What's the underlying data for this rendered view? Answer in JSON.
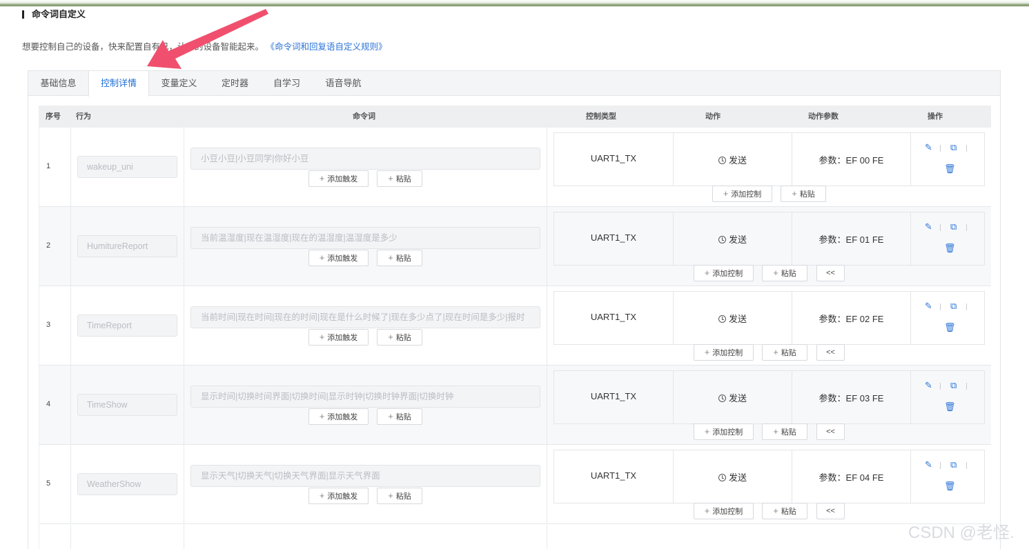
{
  "page": {
    "title": "命令词自定义",
    "description": "想要控制自己的设备，快来配置自有",
    "description_hidden_tail": "己，让你的设备智能起来。",
    "rules_link": "《命令词和回复语自定义规则》"
  },
  "tabs": [
    {
      "label": "基础信息",
      "active": false
    },
    {
      "label": "控制详情",
      "active": true
    },
    {
      "label": "变量定义",
      "active": false
    },
    {
      "label": "定时器",
      "active": false
    },
    {
      "label": "自学习",
      "active": false
    },
    {
      "label": "语音导航",
      "active": false
    }
  ],
  "table": {
    "headers": {
      "seq": "序号",
      "behavior": "行为",
      "command": "命令词",
      "control_type": "控制类型",
      "action": "动作",
      "action_params": "动作参数",
      "operations": "操作"
    },
    "buttons": {
      "add_trigger": "添加触发",
      "paste": "粘贴",
      "add_control": "添加控制",
      "collapse": "<<"
    },
    "rows": [
      {
        "seq": "1",
        "behavior": "wakeup_uni",
        "command": "小豆小豆|小豆同学|你好小豆",
        "control_type": "UART1_TX",
        "action": "发送",
        "params": "参数：EF 00 FE"
      },
      {
        "seq": "2",
        "behavior": "HumitureReport",
        "command": "当前温湿度|现在温湿度|现在的温湿度|温湿度是多少",
        "control_type": "UART1_TX",
        "action": "发送",
        "params": "参数：EF 01 FE"
      },
      {
        "seq": "3",
        "behavior": "TimeReport",
        "command": "当前时间|现在时间|现在的时间|现在是什么时候了|现在多少点了|现在时间是多少|报时",
        "control_type": "UART1_TX",
        "action": "发送",
        "params": "参数：EF 02 FE"
      },
      {
        "seq": "4",
        "behavior": "TimeShow",
        "command": "显示时间|切换时间界面|切换时间|显示时钟|切换时钟界面|切换时钟",
        "control_type": "UART1_TX",
        "action": "发送",
        "params": "参数：EF 03 FE"
      },
      {
        "seq": "5",
        "behavior": "WeatherShow",
        "command": "显示天气|切换天气|切换天气界面|显示天气界面",
        "control_type": "UART1_TX",
        "action": "发送",
        "params": "参数：EF 04 FE"
      }
    ]
  },
  "watermark": "CSDN @老怪.",
  "colors": {
    "accent": "#2b73d7",
    "arrow": "#f0506e"
  }
}
